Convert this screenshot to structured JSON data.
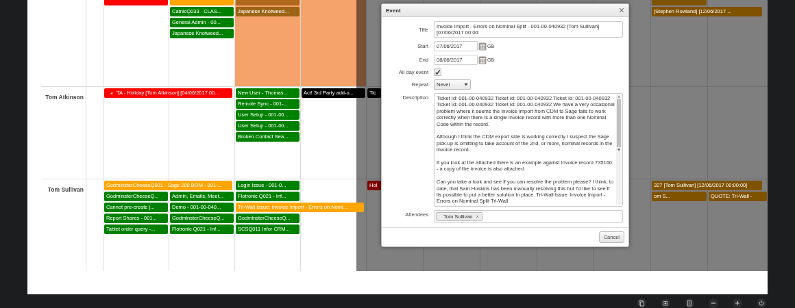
{
  "calendar": {
    "rows": [
      {
        "days": [
          {
            "highlighted": false,
            "events": [
              {
                "kind": "cut",
                "color": "#ff0000"
              }
            ]
          },
          {
            "highlighted": false,
            "events": [
              {
                "kind": "cut",
                "color": "#ffa500"
              },
              {
                "kind": "single",
                "color": "#008000",
                "label": "CatnicQ033 - CLAS..."
              },
              {
                "kind": "single",
                "color": "#008000",
                "label": "General Admin - 00..."
              },
              {
                "kind": "single",
                "color": "#008000",
                "label": "Japanese Knotweed..."
              }
            ]
          },
          {
            "highlighted": true,
            "events": [
              {
                "kind": "cut",
                "color": "#b0681c"
              },
              {
                "kind": "single",
                "color": "#9c6415",
                "label": "Japanese Knotweed..."
              }
            ]
          },
          {
            "highlighted": true
          },
          {
            "highlighted": false
          },
          {
            "highlighted": false
          },
          {
            "highlighted": false
          },
          {
            "highlighted": false
          },
          {
            "highlighted": false
          },
          {
            "highlighted": false,
            "events": [
              {
                "kind": "cut",
                "color": "#7f5200"
              },
              {
                "kind": "wide",
                "color": "#7f5200",
                "label": "[Stephen Rowland] [12/06/2017 ..."
              }
            ]
          },
          {
            "highlighted": false
          }
        ]
      },
      {
        "name": "Tom Atkinson",
        "days": [
          {
            "highlighted": false,
            "events": [
              {
                "kind": "continued",
                "color": "#ff0000",
                "label": "TA - Holiday [Tom Atkinson] [04/06/2017 00..."
              }
            ]
          },
          {
            "highlighted": false
          },
          {
            "highlighted": false,
            "events": [
              {
                "kind": "single",
                "color": "#008000",
                "label": "New User - Thomas..."
              },
              {
                "kind": "single",
                "color": "#008000",
                "label": "Remote Sync - 001-..."
              },
              {
                "kind": "single",
                "color": "#008000",
                "label": "User Setup - 001-00..."
              },
              {
                "kind": "single",
                "color": "#008000",
                "label": "User Setup - 001-00..."
              },
              {
                "kind": "single",
                "color": "#008000",
                "label": "Broken Contact Sea..."
              }
            ]
          },
          {
            "highlighted": false,
            "events": [
              {
                "kind": "single",
                "color": "#000000",
                "label": "Act! 3rd Party add-o..."
              }
            ]
          },
          {
            "highlighted": false,
            "events": [
              {
                "kind": "clipped",
                "color": "#000000",
                "label": "Tic"
              }
            ]
          }
        ],
        "days_right": [
          {
            "highlighted": false
          },
          {
            "highlighted": false
          },
          {
            "highlighted": false
          }
        ]
      },
      {
        "name": "Tom Sullivan",
        "days": [
          {
            "highlighted": false,
            "events": [
              {
                "kind": "wide",
                "color": "#ffa500",
                "label": "GodminsterCheeseQ001 - Sage 200 BOM - 001-..."
              },
              {
                "kind": "single",
                "color": "#008000",
                "label": "GodminsterCheeseQ..."
              },
              {
                "kind": "single",
                "color": "#008000",
                "label": "Cannot pre-create j..."
              },
              {
                "kind": "single",
                "color": "#008000",
                "label": "Report Shares - 001..."
              },
              {
                "kind": "single",
                "color": "#008000",
                "label": "Tablet order query -..."
              }
            ]
          },
          {
            "highlighted": false,
            "events": [
              {
                "kind": "lower",
                "color": "#008000",
                "label": "Admin, Emails, Meet..."
              },
              {
                "kind": "single",
                "color": "#008000",
                "label": "Demo - 001-00-040..."
              },
              {
                "kind": "single",
                "color": "#008000",
                "label": "GodminsterCheeseQ..."
              },
              {
                "kind": "single",
                "color": "#008000",
                "label": "Flotronic Q021 - Inf..."
              }
            ]
          },
          {
            "highlighted": false,
            "events": [
              {
                "kind": "single",
                "color": "#008000",
                "label": "Login Issue - 001-0..."
              },
              {
                "kind": "single",
                "color": "#008000",
                "label": "Flotronic Q021 - Inf..."
              },
              {
                "kind": "wide",
                "color": "#ffa500",
                "label": "Tri-Wall Issue: Invoice Import - Errors on Nomi..."
              },
              {
                "kind": "single",
                "color": "#008000",
                "label": "GodminsterCheeseQ..."
              },
              {
                "kind": "single",
                "color": "#008000",
                "label": "SCSQ011 Infor CRM..."
              }
            ]
          },
          {
            "highlighted": false
          },
          {
            "highlighted": false,
            "events": [
              {
                "kind": "clipped",
                "color": "#7f0000",
                "label": "Hol"
              }
            ]
          },
          {
            "highlighted": false
          },
          {
            "highlighted": false
          },
          {
            "highlighted": false
          },
          {
            "highlighted": false
          },
          {
            "highlighted": false,
            "events": [
              {
                "kind": "wide",
                "color": "#7f5200",
                "label": "327 [Tom Sullivan] [12/06/2017 00:00:00]"
              },
              {
                "kind": "single",
                "color": "#7f5200",
                "label": "om S..."
              }
            ]
          },
          {
            "highlighted": false,
            "events": [
              {
                "kind": "lower",
                "color": "#7f5200",
                "label": "QUOTE: Tri-Wall -"
              }
            ]
          }
        ]
      }
    ]
  },
  "dialog": {
    "title": "Event",
    "title_field": {
      "label": "Title",
      "value": "Invoice Import - Errors on Nominal Split - 001-00-040932 [Tom Sullivan] [07/06/2017 00:00:"
    },
    "start": {
      "label": "Start",
      "value": "07/06/2017",
      "suffix": "GB"
    },
    "end": {
      "label": "End",
      "value": "08/06/2017",
      "suffix": "GB"
    },
    "all_day": {
      "label": "All day event",
      "checked": true
    },
    "repeat": {
      "label": "Repeat",
      "value": "Never"
    },
    "description": {
      "label": "Description",
      "paragraphs": [
        "Ticket Id: 001-00-040932 Ticket Id: 001-00-040932 Ticket Id: 001-00-040932 Ticket Id: 001-00-040932 Ticket Id: 001-00-040932 We have a very occasional problem where it seems the Invoice import from CDM to Sage fails to work correctly when there is a single invoice record with more than one Nominal Code within the record.",
        "Although I think the CDM export side is working correctly I suspect the Sage pick-up is omitting to take account of the 2nd, or more, nominal records in the invoice record.",
        "If you look at the attached there is an example against Invoice record 735160 - a copy of the invoice is also attached.",
        "Can you take a look and see if you can resolve the problem please? I think, to date, that Sam Hoskins has been manually resolving this but I'd like to see if its possible to put a better solution in place.  Tri-Wall Issue: Invoice Import - Errors on Nominal Split  Tri-Wall"
      ]
    },
    "attendees": {
      "label": "Attendees",
      "tags": [
        "Tom Sullivan"
      ]
    },
    "buttons": [
      "Cancel"
    ]
  }
}
